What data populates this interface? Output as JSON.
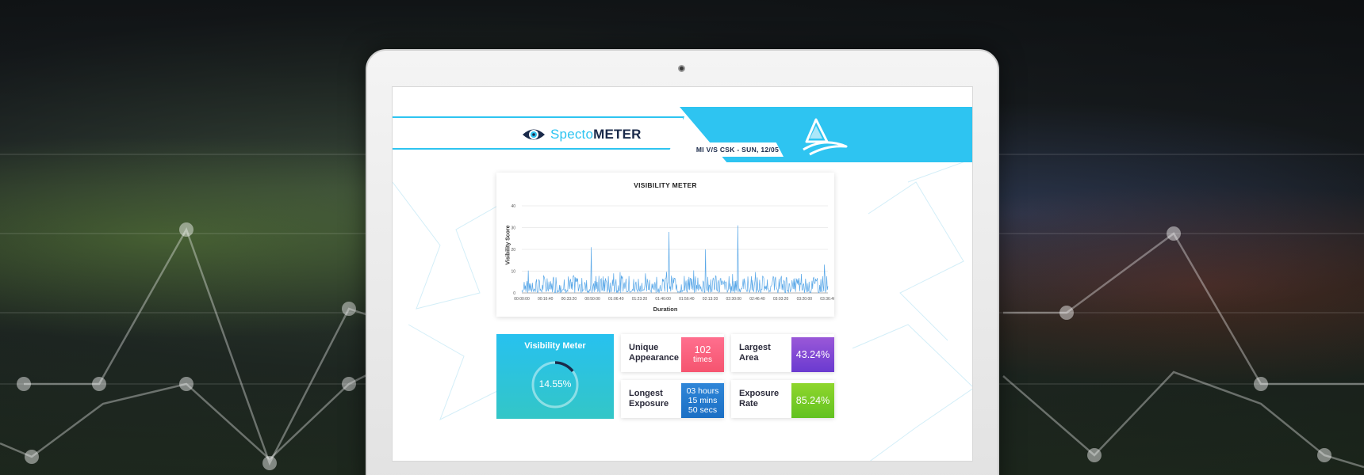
{
  "header": {
    "logo_prefix": "Specto",
    "logo_suffix": "METER",
    "match_label": "MI V/S CSK - SUN, 12/05"
  },
  "chart_data": {
    "type": "line",
    "title": "VISIBILITY METER",
    "xlabel": "Duration",
    "ylabel": "Visibility Score",
    "ylim": [
      0,
      40
    ],
    "yticks": [
      "0",
      "10",
      "20",
      "30",
      "40"
    ],
    "xticks": [
      "00:00:00",
      "00:16:40",
      "00:33:20",
      "00:50:00",
      "01:06:40",
      "01:23:20",
      "01:40:00",
      "01:56:40",
      "02:13:20",
      "02:30:00",
      "02:46:40",
      "03:03:20",
      "03:20:00",
      "03:36:40"
    ],
    "grid": true,
    "series": [
      {
        "color": "#5aa8e8",
        "peaks": [
          {
            "x": "00:49:00",
            "y": 21
          },
          {
            "x": "01:05:00",
            "y": 9
          },
          {
            "x": "01:44:00",
            "y": 28
          },
          {
            "x": "02:10:00",
            "y": 20
          },
          {
            "x": "02:33:00",
            "y": 31
          },
          {
            "x": "03:34:00",
            "y": 13
          }
        ],
        "baseline_range": [
          3,
          8
        ]
      }
    ]
  },
  "visibility_meter": {
    "title": "Visibility Meter",
    "value": "14.55%",
    "fraction": 0.1455
  },
  "stats": [
    {
      "label_1": "Unique",
      "label_2": "Appearance",
      "value_1": "102",
      "value_2": "times",
      "color": "#f5546f"
    },
    {
      "label_1": "Largest",
      "label_2": "Area",
      "value_1": "43.24%",
      "color": "#7a46d4"
    },
    {
      "label_1": "Longest",
      "label_2": "Exposure",
      "value_1": "03 hours",
      "value_2": "15 mins",
      "value_3": "50 secs",
      "color": "#1b6fc4"
    },
    {
      "label_1": "Exposure",
      "label_2": "Rate",
      "value_1": "85.24%",
      "color": "#6cc424"
    }
  ]
}
